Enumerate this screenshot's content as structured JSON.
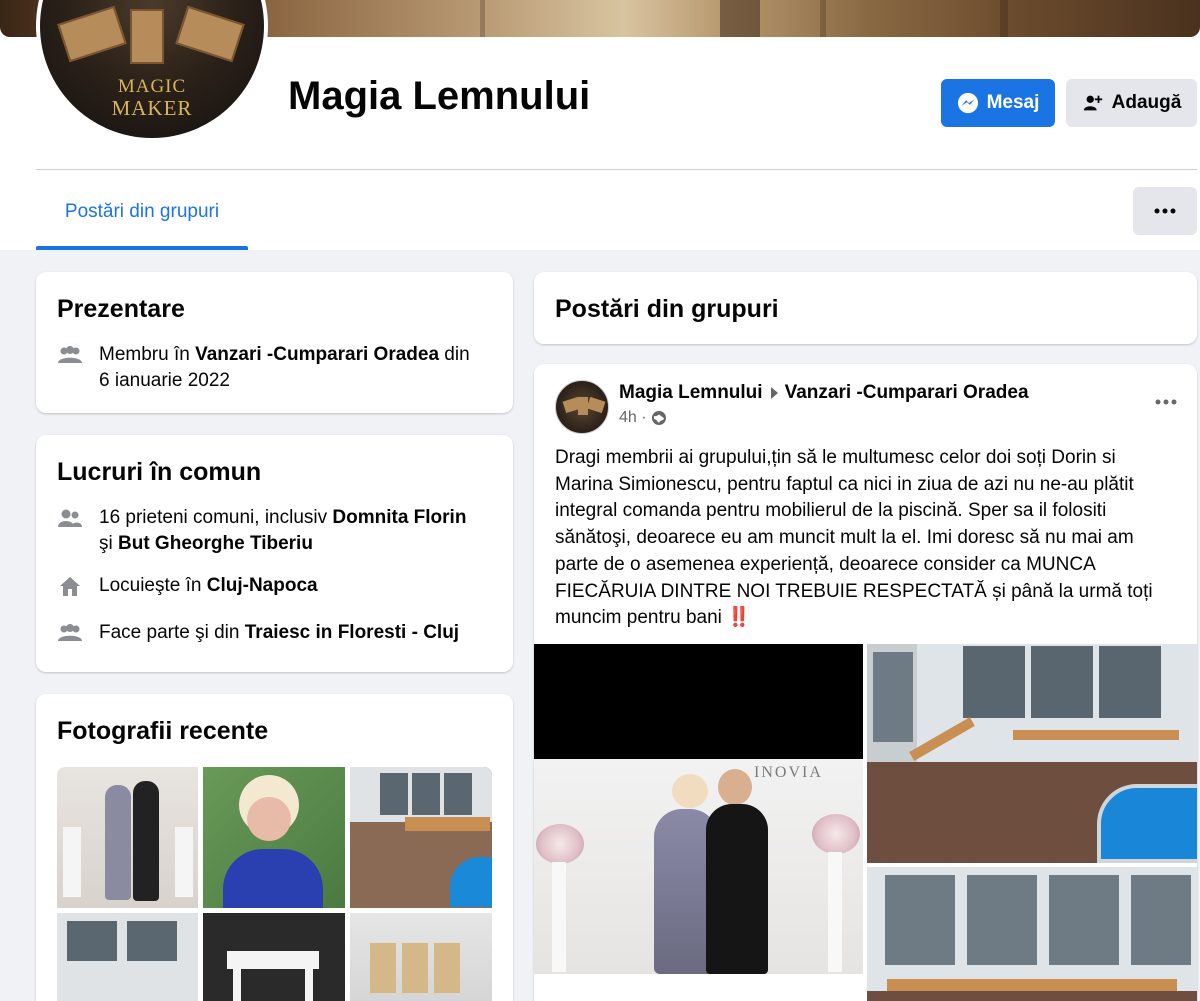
{
  "profile": {
    "name": "Magia Lemnului",
    "avatar_logo_line1": "MAGIC",
    "avatar_logo_line2": "MAKER"
  },
  "actions": {
    "message_label": "Mesaj",
    "add_label": "Adaugă"
  },
  "tabs": {
    "active_label": "Postări din grupuri"
  },
  "intro": {
    "title": "Prezentare",
    "member_prefix": "Membru în ",
    "member_group": "Vanzari -Cumparari Oradea",
    "member_suffix": " din",
    "member_date": "6 ianuarie 2022"
  },
  "common": {
    "title": "Lucruri în comun",
    "friends_prefix": "16 prieteni comuni, inclusiv ",
    "friend1": "Domnita Florin",
    "friends_and": "şi ",
    "friend2": "But Gheorghe Tiberiu",
    "lives_prefix": "Locuieşte în ",
    "lives_city": "Cluj-Napoca",
    "member_prefix": "Face parte şi din ",
    "member_group": "Traiesc in Floresti - Cluj"
  },
  "photos": {
    "title": "Fotografii recente"
  },
  "group_posts": {
    "title": "Postări din grupuri"
  },
  "post": {
    "author": "Magia Lemnului",
    "group": "Vanzari -Cumparari Oradea",
    "time": "4h ·",
    "text": "Dragi membrii ai grupului,țin să le multumesc celor doi soți Dorin si Marina Simionescu, pentru faptul ca nici in ziua de azi nu ne-au plătit integral comanda pentru mobilierul de la piscină. Sper sa il folositi sănătoşi, deoarece eu am muncit mult la el. Imi doresc să nu mai am parte de o asemenea experiență, deoarece consider ca MUNCA FIECĂRUIA DINTRE NOI TREBUIE RESPECTATĂ și până la urmă toți muncim pentru bani",
    "emoji": "‼️",
    "banner_text": "INOVIA"
  },
  "colors": {
    "accent": "#1b74e4",
    "background": "#f0f2f5",
    "secondary_text": "#65676b"
  }
}
